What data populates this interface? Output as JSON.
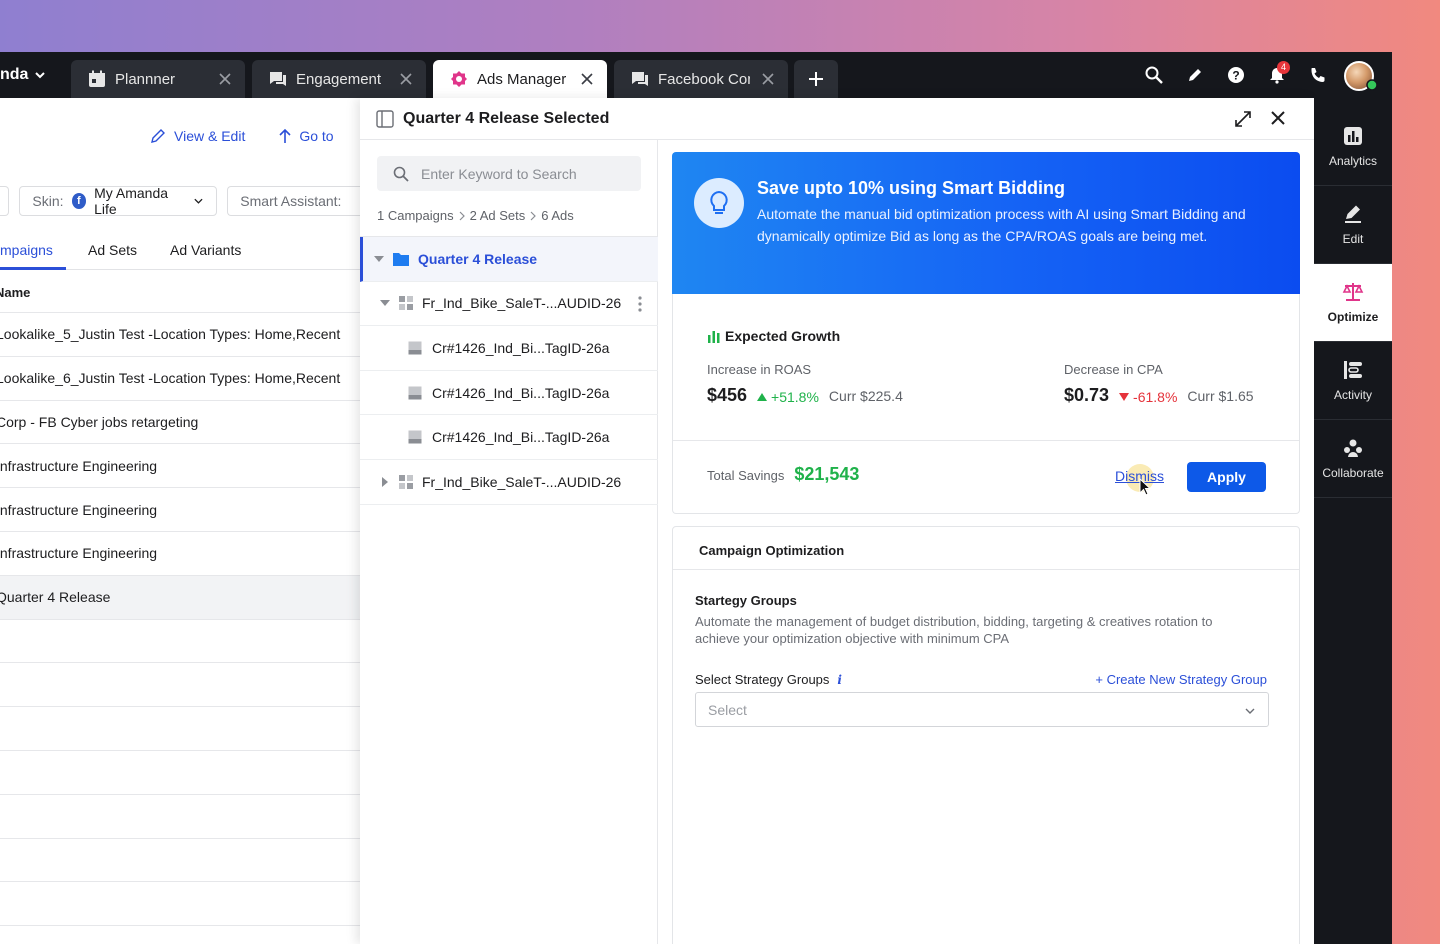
{
  "topbar": {
    "account": "nda",
    "tabs": [
      {
        "label": "Plannner",
        "icon": "calendar-icon"
      },
      {
        "label": "Engagement",
        "icon": "chat-icon"
      },
      {
        "label": "Ads Manager",
        "icon": "ads-manager-icon",
        "active": true
      },
      {
        "label": "Facebook Con",
        "icon": "chat-icon"
      }
    ],
    "notification_count": "4",
    "icons": [
      "search-icon",
      "pencil-icon",
      "help-icon",
      "bell-icon",
      "phone-icon"
    ]
  },
  "background": {
    "actions": {
      "view_edit": "View & Edit",
      "go_to": "Go to"
    },
    "skin_label": "Skin:",
    "skin_value": "My Amanda Life",
    "smart_assistant": "Smart Assistant:",
    "tabs": [
      "mpaigns",
      "Ad Sets",
      "Ad Variants"
    ],
    "column_header": "Name",
    "rows": [
      "Lookalike_5_Justin Test -Location Types: Home,Recent",
      "Lookalike_6_Justin Test -Location Types: Home,Recent",
      "Corp - FB Cyber jobs retargeting",
      "Infrastructure Engineering",
      "Infrastructure Engineering",
      "Infrastructure Engineering",
      "Quarter 4 Release"
    ]
  },
  "drawer": {
    "title": "Quarter 4 Release Selected",
    "search_placeholder": "Enter Keyword to Search",
    "breadcrumb": [
      "1 Campaigns",
      "2 Ad Sets",
      "6 Ads"
    ],
    "tree": {
      "root": "Quarter 4 Release",
      "adsets": [
        {
          "label": "Fr_Ind_Bike_SaleT-...AUDID-26",
          "expanded": true,
          "ads": [
            "Cr#1426_Ind_Bi...TagID-26a",
            "Cr#1426_Ind_Bi...TagID-26a",
            "Cr#1426_Ind_Bi...TagID-26a"
          ]
        },
        {
          "label": "Fr_Ind_Bike_SaleT-...AUDID-26",
          "expanded": false,
          "ads": []
        }
      ]
    }
  },
  "optimization": {
    "banner_title": "Save upto 10% using Smart Bidding",
    "banner_desc": "Automate the manual bid optimization process with AI using Smart Bidding and dynamically optimize Bid as long as the CPA/ROAS goals are being met.",
    "expected_growth": "Expected Growth",
    "roas": {
      "label": "Increase in ROAS",
      "value": "$456",
      "change": "+51.8%",
      "curr": "Curr $225.4"
    },
    "cpa": {
      "label": "Decrease in CPA",
      "value": "$0.73",
      "change": "-61.8%",
      "curr": "Curr $1.65"
    },
    "savings_label": "Total Savings",
    "savings_value": "$21,543",
    "dismiss": "Dismiss",
    "apply": "Apply",
    "campaign_opt_title": "Campaign Optimization",
    "strategy_title": "Startegy Groups",
    "strategy_desc": "Automate the management of budget distribution, bidding, targeting & creatives rotation to achieve your optimization objective with minimum CPA",
    "select_label": "Select Strategy Groups",
    "create_link": "+ Create New Strategy Group",
    "select_placeholder": "Select"
  },
  "rail": [
    {
      "label": "Analytics",
      "icon": "analytics-icon"
    },
    {
      "label": "Edit",
      "icon": "edit-icon"
    },
    {
      "label": "Optimize",
      "icon": "scale-icon",
      "active": true
    },
    {
      "label": "Activity",
      "icon": "activity-icon"
    },
    {
      "label": "Collaborate",
      "icon": "collaborate-icon"
    }
  ],
  "colors": {
    "accent": "#2b4fd8",
    "apply": "#0d59e8",
    "positive": "#1fb24a",
    "negative": "#e5333b",
    "dark": "#15171c"
  }
}
